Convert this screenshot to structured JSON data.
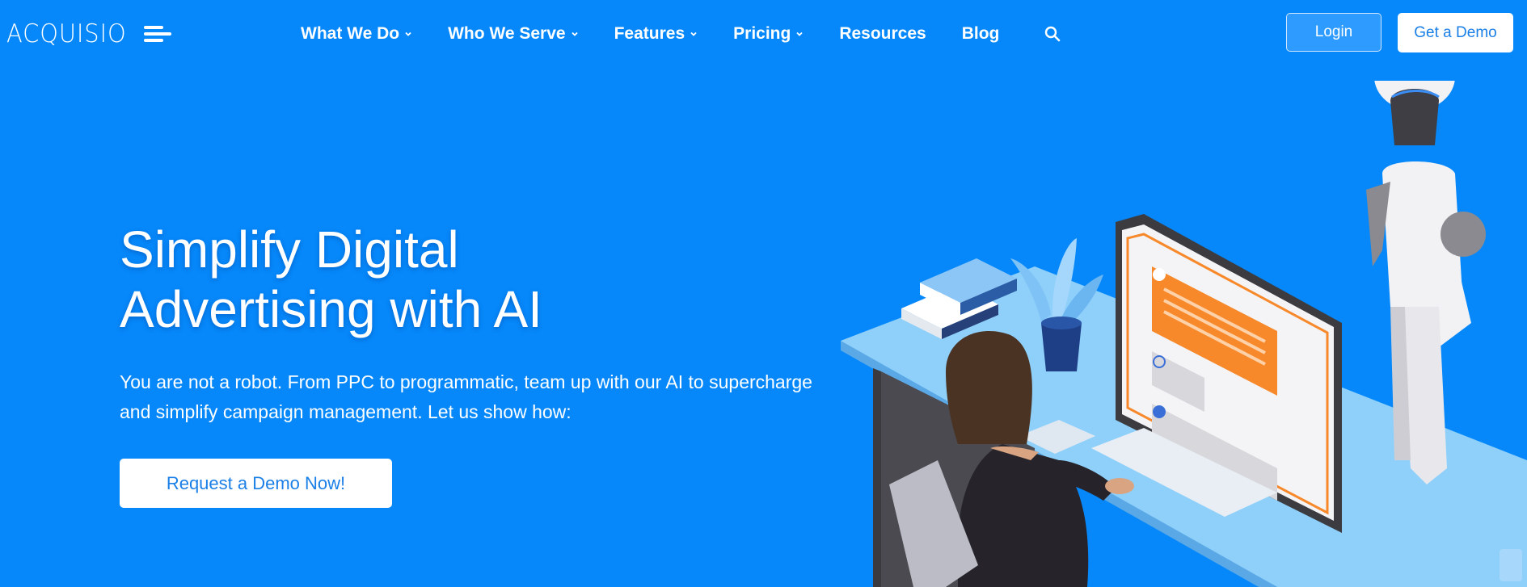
{
  "brand": {
    "name": "ACQUISIO"
  },
  "nav": {
    "items": [
      {
        "label": "What We Do",
        "has_dropdown": true
      },
      {
        "label": "Who We Serve",
        "has_dropdown": true
      },
      {
        "label": "Features",
        "has_dropdown": true
      },
      {
        "label": "Pricing",
        "has_dropdown": true
      },
      {
        "label": "Resources",
        "has_dropdown": false
      },
      {
        "label": "Blog",
        "has_dropdown": false
      }
    ],
    "search_icon": "search-icon"
  },
  "header": {
    "login_label": "Login",
    "demo_label": "Get a Demo"
  },
  "hero": {
    "title_line1": "Simplify Digital",
    "title_line2": "Advertising with AI",
    "subtitle": "You are not a robot. From PPC to programmatic, team up with our AI to supercharge and simplify campaign management. Let us show how:",
    "cta_label": "Request a Demo Now!"
  },
  "colors": {
    "background": "#0688fa",
    "button_text": "#1a7fe6",
    "accent_orange": "#f7892b"
  },
  "illustration": {
    "description_icons": [
      "facebook-icon",
      "instagram-icon",
      "facebook-icon"
    ]
  }
}
